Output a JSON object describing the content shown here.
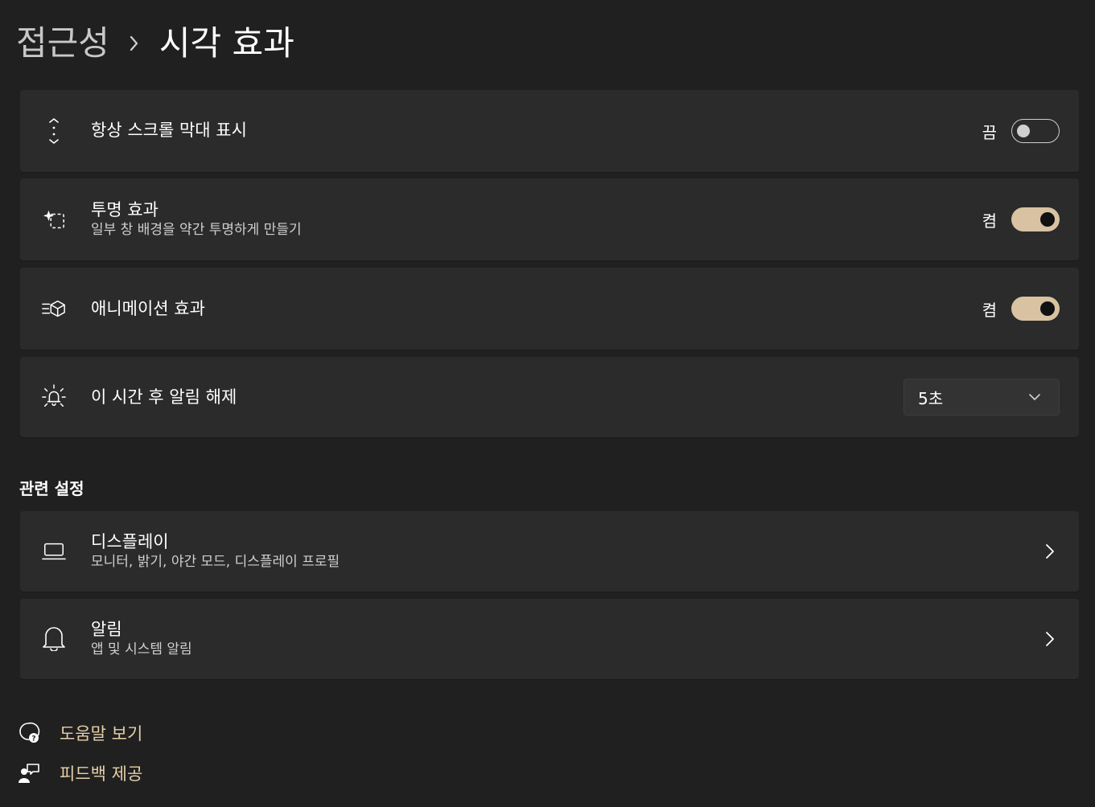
{
  "breadcrumb": {
    "parent": "접근성",
    "current": "시각 효과"
  },
  "settings": [
    {
      "icon": "scrollbar-icon",
      "title": "항상 스크롤 막대 표시",
      "subtitle": "",
      "control": "toggle",
      "state_label": "끔",
      "on": false
    },
    {
      "icon": "transparency-icon",
      "title": "투명 효과",
      "subtitle": "일부 창 배경을 약간 투명하게 만들기",
      "control": "toggle",
      "state_label": "켬",
      "on": true
    },
    {
      "icon": "animation-icon",
      "title": "애니메이션 효과",
      "subtitle": "",
      "control": "toggle",
      "state_label": "켬",
      "on": true
    },
    {
      "icon": "notification-timeout-icon",
      "title": "이 시간 후 알림 해제",
      "subtitle": "",
      "control": "dropdown",
      "value": "5초"
    }
  ],
  "related": {
    "title": "관련 설정",
    "items": [
      {
        "icon": "laptop-icon",
        "title": "디스플레이",
        "subtitle": "모니터, 밝기, 야간 모드, 디스플레이 프로필"
      },
      {
        "icon": "bell-icon",
        "title": "알림",
        "subtitle": "앱 및 시스템 알림"
      }
    ]
  },
  "footer": {
    "help": "도움말 보기",
    "feedback": "피드백 제공"
  },
  "colors": {
    "background": "#202020",
    "card": "#2b2b2b",
    "accent": "#d8c2a2",
    "link": "#e6cfa9"
  }
}
